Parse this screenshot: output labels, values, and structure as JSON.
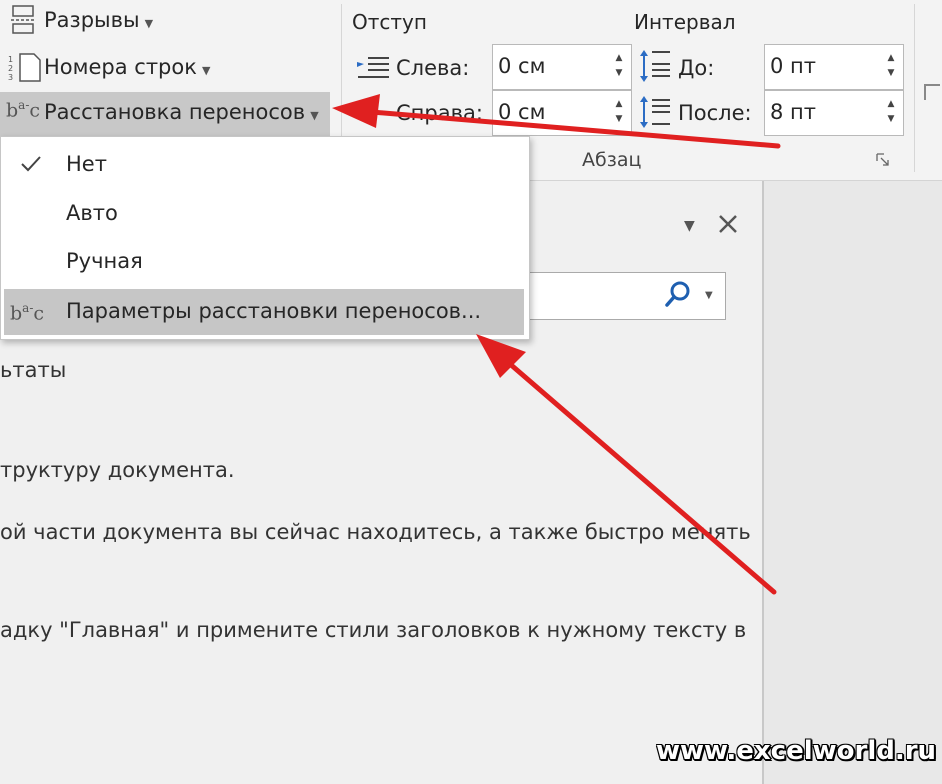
{
  "ribbon": {
    "breaks_label": "Разрывы",
    "line_numbers_label": "Номера строк",
    "hyphenation_label": "Расстановка переносов",
    "indent": {
      "group_label": "Отступ",
      "left_label": "Слева:",
      "left_value": "0 см",
      "right_label": "Справа:",
      "right_value": "0 см"
    },
    "spacing": {
      "group_label": "Интервал",
      "before_label": "До:",
      "before_value": "0 пт",
      "after_label": "После:",
      "after_value": "8 пт"
    },
    "paragraph_group_label": "Абзац"
  },
  "hyphenation_menu": {
    "items": [
      {
        "label": "Нет",
        "checked": true
      },
      {
        "label": "Авто",
        "checked": false
      },
      {
        "label": "Ручная",
        "checked": false
      },
      {
        "label": "Параметры расстановки переносов...",
        "checked": false
      }
    ]
  },
  "nav_pane": {
    "results_fragment": "ьтаты",
    "lines": [
      "труктуру документа.",
      "ой части документа вы сейчас находитесь, а также быстро менять",
      "адку \"Главная\" и примените стили заголовков к нужному тексту в"
    ]
  },
  "icons": {
    "hyphenation": "bc-hyphenation-icon",
    "check": "check-icon",
    "search": "search-icon",
    "close": "close-icon"
  },
  "colors": {
    "arrow": "#e02020",
    "search_icon": "#1e5fb0"
  },
  "watermark": "www.excelworld.ru"
}
